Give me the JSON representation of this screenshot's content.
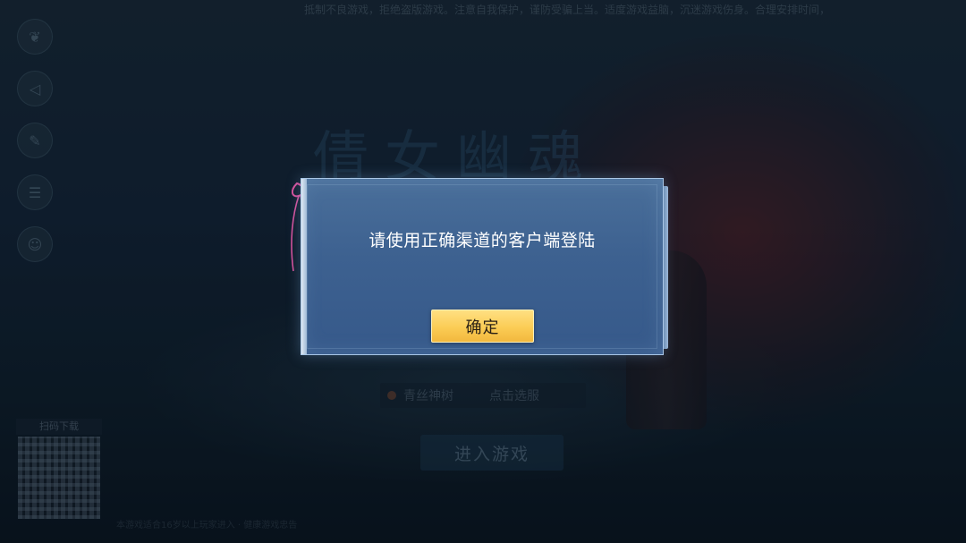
{
  "background": {
    "top_notice": "抵制不良游戏，拒绝盗版游戏。注意自我保护，谨防受骗上当。适度游戏益脑，沉迷游戏伤身。合理安排时间，享受健康生活。",
    "game_logo": "倩女幽魂",
    "side_icons": [
      "announcement-icon",
      "speaker-icon",
      "settings-icon",
      "account-icon",
      "service-icon"
    ],
    "server_name": "青丝神树",
    "server_switch": "点击选服",
    "enter_game": "进入游戏",
    "qr_label": "扫码下载",
    "bottom_text": "本游戏适合16岁以上玩家进入 · 健康游戏忠告"
  },
  "dialog": {
    "message": "请使用正确渠道的客户端登陆",
    "confirm_label": "确定"
  },
  "colors": {
    "dialog_bg": "#3d6190",
    "dialog_border": "#a9c6e6",
    "button_bg": "#fbcc55",
    "button_text": "#2a2015",
    "ribbon": "#d4509a"
  }
}
